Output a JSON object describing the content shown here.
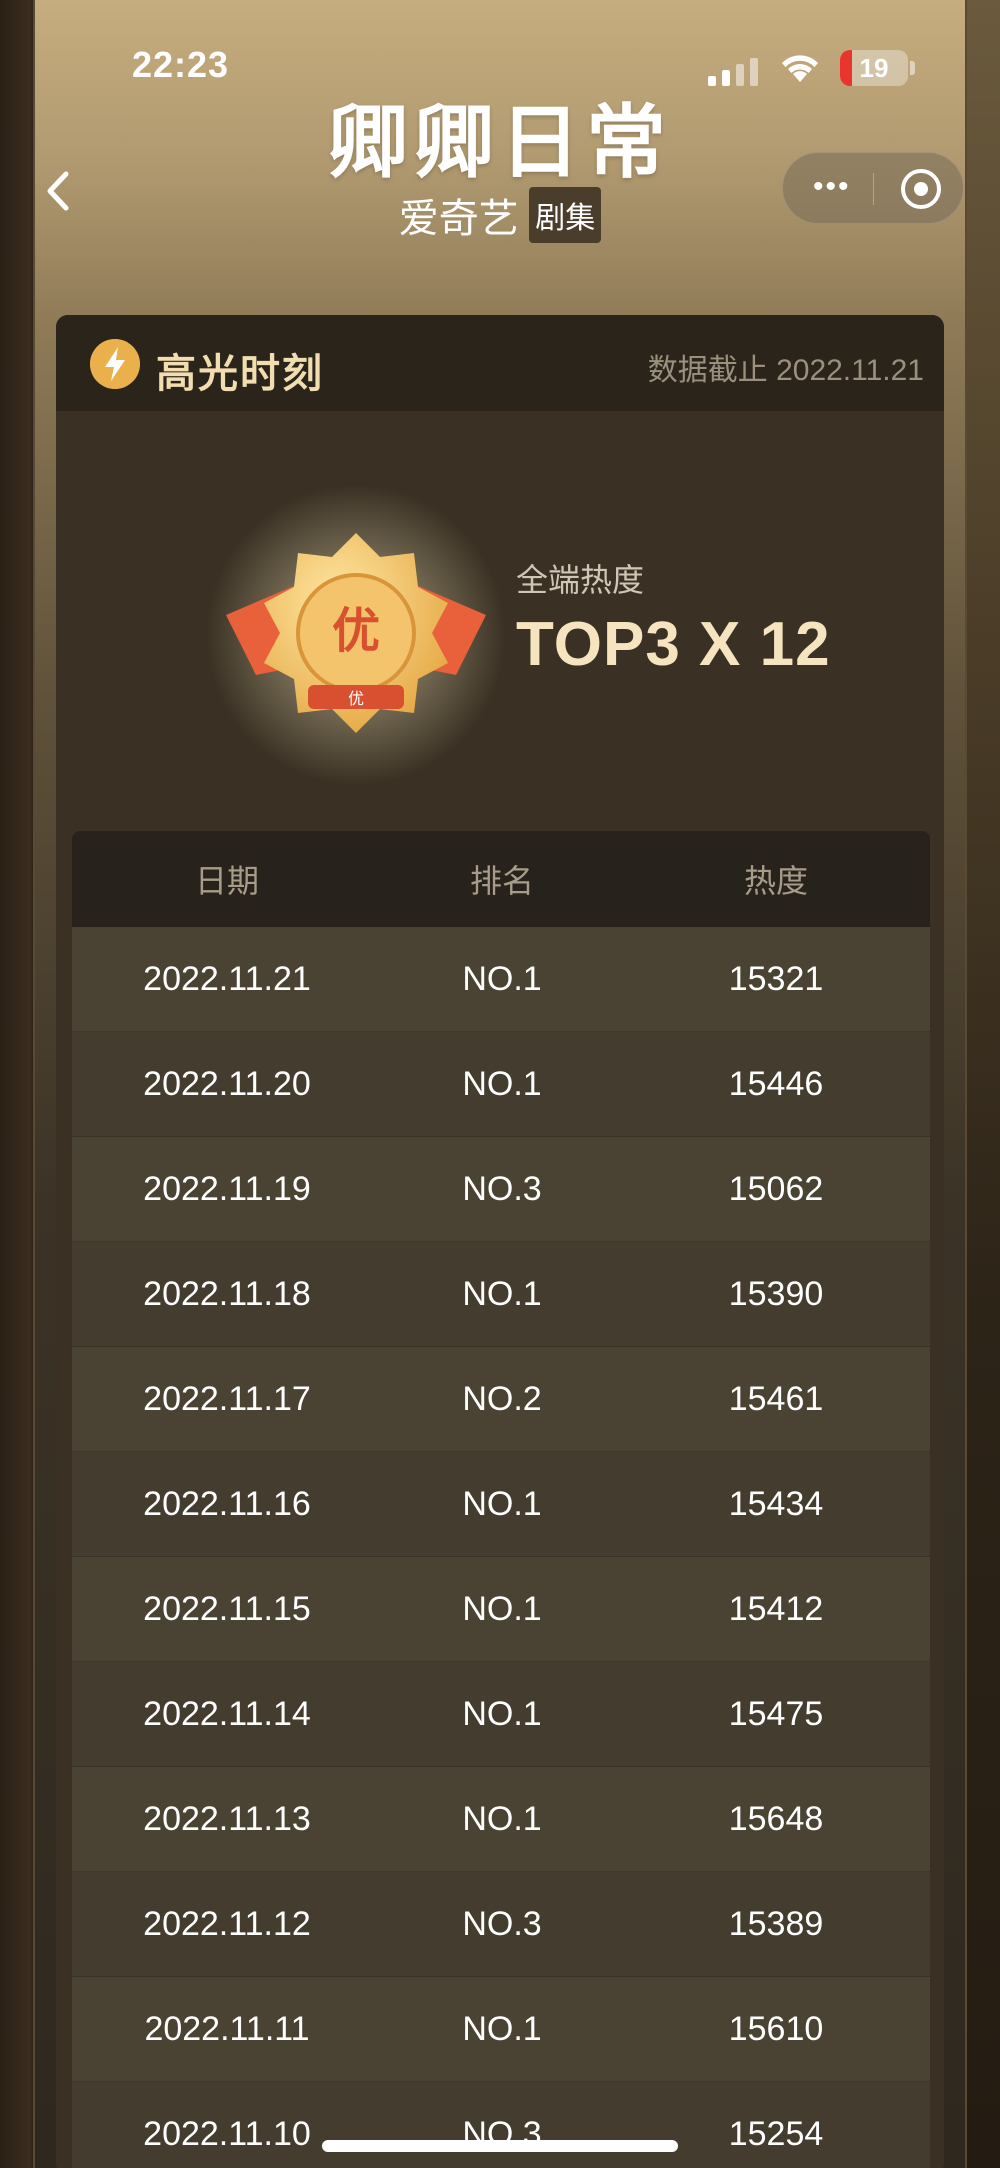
{
  "status_bar": {
    "time": "22:23",
    "battery": "19"
  },
  "header": {
    "title": "卿卿日常",
    "subtitle": "爱奇艺",
    "tag": "剧集"
  },
  "card": {
    "title": "高光时刻",
    "date_note": "数据截止 2022.11.21",
    "badge_text": "优",
    "badge_ribbon": "优",
    "stat_label": "全端热度",
    "stat_value": "TOP3 X 12",
    "table": {
      "headers": [
        "日期",
        "排名",
        "热度"
      ],
      "rows": [
        [
          "2022.11.21",
          "NO.1",
          "15321"
        ],
        [
          "2022.11.20",
          "NO.1",
          "15446"
        ],
        [
          "2022.11.19",
          "NO.3",
          "15062"
        ],
        [
          "2022.11.18",
          "NO.1",
          "15390"
        ],
        [
          "2022.11.17",
          "NO.2",
          "15461"
        ],
        [
          "2022.11.16",
          "NO.1",
          "15434"
        ],
        [
          "2022.11.15",
          "NO.1",
          "15412"
        ],
        [
          "2022.11.14",
          "NO.1",
          "15475"
        ],
        [
          "2022.11.13",
          "NO.1",
          "15648"
        ],
        [
          "2022.11.12",
          "NO.3",
          "15389"
        ],
        [
          "2022.11.11",
          "NO.1",
          "15610"
        ],
        [
          "2022.11.10",
          "NO.3",
          "15254"
        ]
      ]
    }
  }
}
